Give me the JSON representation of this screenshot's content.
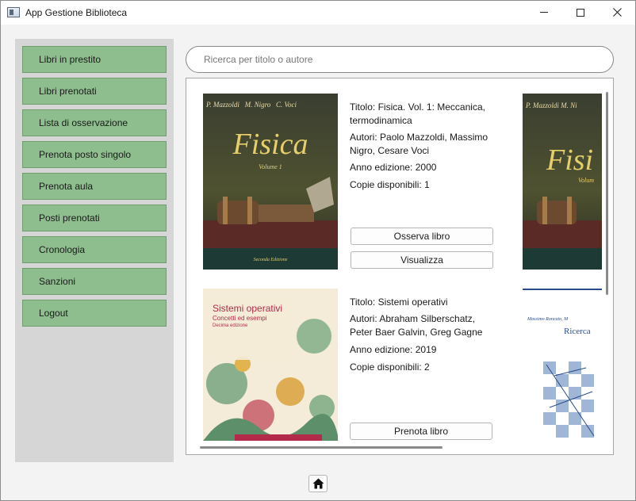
{
  "window": {
    "title": "App Gestione Biblioteca"
  },
  "sidebar": {
    "items": [
      {
        "label": "Libri in prestito"
      },
      {
        "label": "Libri prenotati"
      },
      {
        "label": "Lista di osservazione"
      },
      {
        "label": "Prenota posto singolo"
      },
      {
        "label": "Prenota aula"
      },
      {
        "label": "Posti prenotati"
      },
      {
        "label": "Cronologia"
      },
      {
        "label": "Sanzioni"
      },
      {
        "label": "Logout"
      }
    ],
    "button_color": "#8ebd8e"
  },
  "search": {
    "placeholder": "Ricerca per titolo o autore"
  },
  "books": [
    {
      "title_line": "Titolo: Fisica. Vol. 1: Meccanica, termodinamica",
      "title_l1": "Titolo: Fisica. Vol. 1: Meccanica,",
      "title_l2": "termodinamica",
      "authors_l1": "Autori: Paolo Mazzoldi, Massimo",
      "authors_l2": "Nigro, Cesare Voci",
      "year": "Anno edizione: 2000",
      "copies": "Copie disponibili: 1",
      "buttons": [
        "Osserva libro",
        "Visualizza"
      ],
      "cover": {
        "authors": "P. Mazzoldi   M. Nigro   C. Voci",
        "title": "Fisica",
        "volume": "Volume 1",
        "edition": "Seconda Edizione"
      }
    },
    {
      "title_line": "Titolo: Sistemi operativi",
      "authors_l1": "Autori: Abraham Silberschatz,",
      "authors_l2": "Peter Baer Galvin, Greg Gagne",
      "year": "Anno edizione: 2019",
      "copies": "Copie disponibili: 2",
      "buttons": [
        "Prenota libro"
      ],
      "cover": {
        "title": "Sistemi operativi",
        "subtitle": "Concetti ed esempi",
        "edition": "Decima edizione"
      }
    }
  ],
  "partial_covers": {
    "second_cover_title": "Ricerca"
  },
  "icons": {
    "app": "app-window-icon",
    "minimize": "minimize-icon",
    "maximize": "maximize-icon",
    "close": "close-icon",
    "home": "home-icon"
  }
}
